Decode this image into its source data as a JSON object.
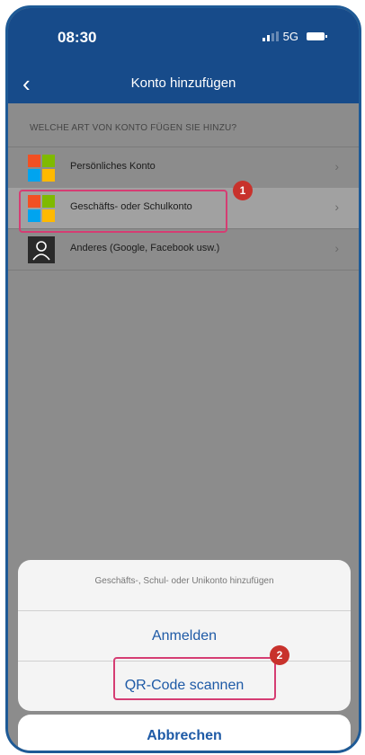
{
  "status": {
    "time": "08:30",
    "network": "5G"
  },
  "nav": {
    "title": "Konto hinzufügen",
    "back_glyph": "‹"
  },
  "section": {
    "header": "WELCHE ART VON KONTO FÜGEN SIE HINZU?"
  },
  "rows": [
    {
      "label": "Persönliches Konto",
      "icon": "microsoft-logo-icon"
    },
    {
      "label": "Geschäfts- oder Schulkonto",
      "icon": "microsoft-logo-icon"
    },
    {
      "label": "Anderes (Google, Facebook usw.)",
      "icon": "person-icon"
    }
  ],
  "chevron": "›",
  "badges": {
    "one": "1",
    "two": "2"
  },
  "sheet": {
    "title": "Geschäfts-, Schul- oder Unikonto hinzufügen",
    "sign_in": "Anmelden",
    "scan_qr": "QR-Code scannen",
    "cancel": "Abbrechen"
  },
  "colors": {
    "brand": "#174b8a",
    "accent": "#1e5aa6",
    "highlight": "#d53d73",
    "badge": "#c8322c",
    "ms_red": "#f25022",
    "ms_green": "#7fba00",
    "ms_blue": "#00a4ef",
    "ms_yellow": "#ffb900"
  }
}
